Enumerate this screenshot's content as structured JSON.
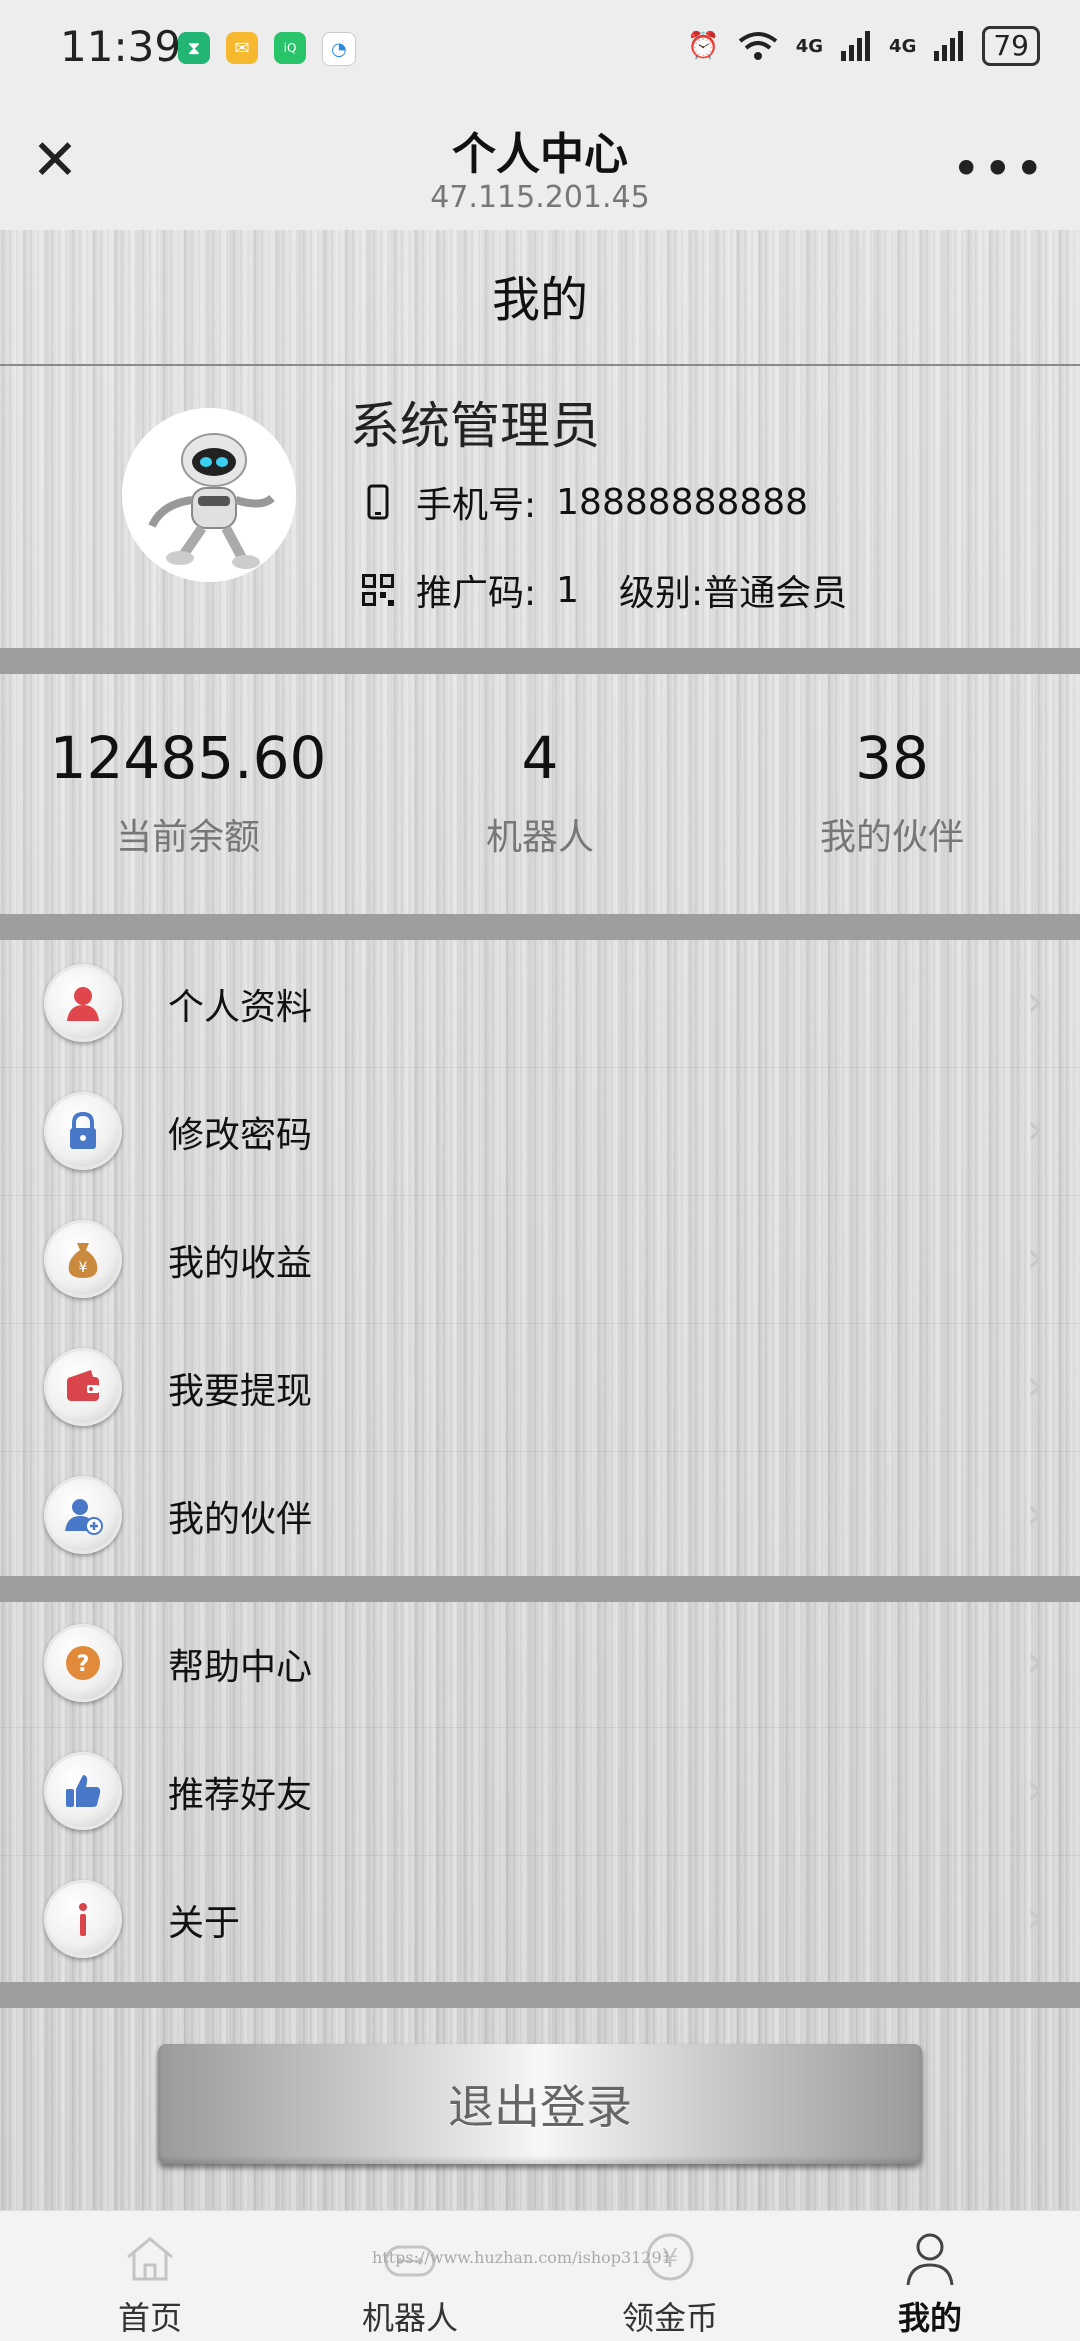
{
  "status_bar": {
    "time": "11:39",
    "battery": "79",
    "network_1": "4G",
    "network_2": "4G"
  },
  "nav": {
    "title": "个人中心",
    "subtitle": "47.115.201.45"
  },
  "page": {
    "title": "我的"
  },
  "profile": {
    "name": "系统管理员",
    "phone_label": "手机号:",
    "phone": "18888888888",
    "promo_label": "推广码:",
    "promo_code": "1",
    "level_label": "级别:",
    "level": "普通会员"
  },
  "stats": [
    {
      "value": "12485.60",
      "label": "当前余额"
    },
    {
      "value": "4",
      "label": "机器人"
    },
    {
      "value": "38",
      "label": "我的伙伴"
    }
  ],
  "menu_group_1": [
    {
      "label": "个人资料",
      "icon": "user-icon"
    },
    {
      "label": "修改密码",
      "icon": "lock-icon"
    },
    {
      "label": "我的收益",
      "icon": "money-bag-icon"
    },
    {
      "label": "我要提现",
      "icon": "wallet-icon"
    },
    {
      "label": "我的伙伴",
      "icon": "add-user-icon"
    }
  ],
  "menu_group_2": [
    {
      "label": "帮助中心",
      "icon": "help-icon"
    },
    {
      "label": "推荐好友",
      "icon": "thumbs-up-icon"
    },
    {
      "label": "关于",
      "icon": "info-icon"
    }
  ],
  "logout": {
    "label": "退出登录"
  },
  "tabbar": [
    {
      "label": "首页",
      "icon": "home-icon",
      "active": false
    },
    {
      "label": "机器人",
      "icon": "robot-icon",
      "active": false
    },
    {
      "label": "领金币",
      "icon": "yen-coin-icon",
      "active": false
    },
    {
      "label": "我的",
      "icon": "person-icon",
      "active": true
    }
  ],
  "watermark": "https://www.huzhan.com/ishop31291"
}
